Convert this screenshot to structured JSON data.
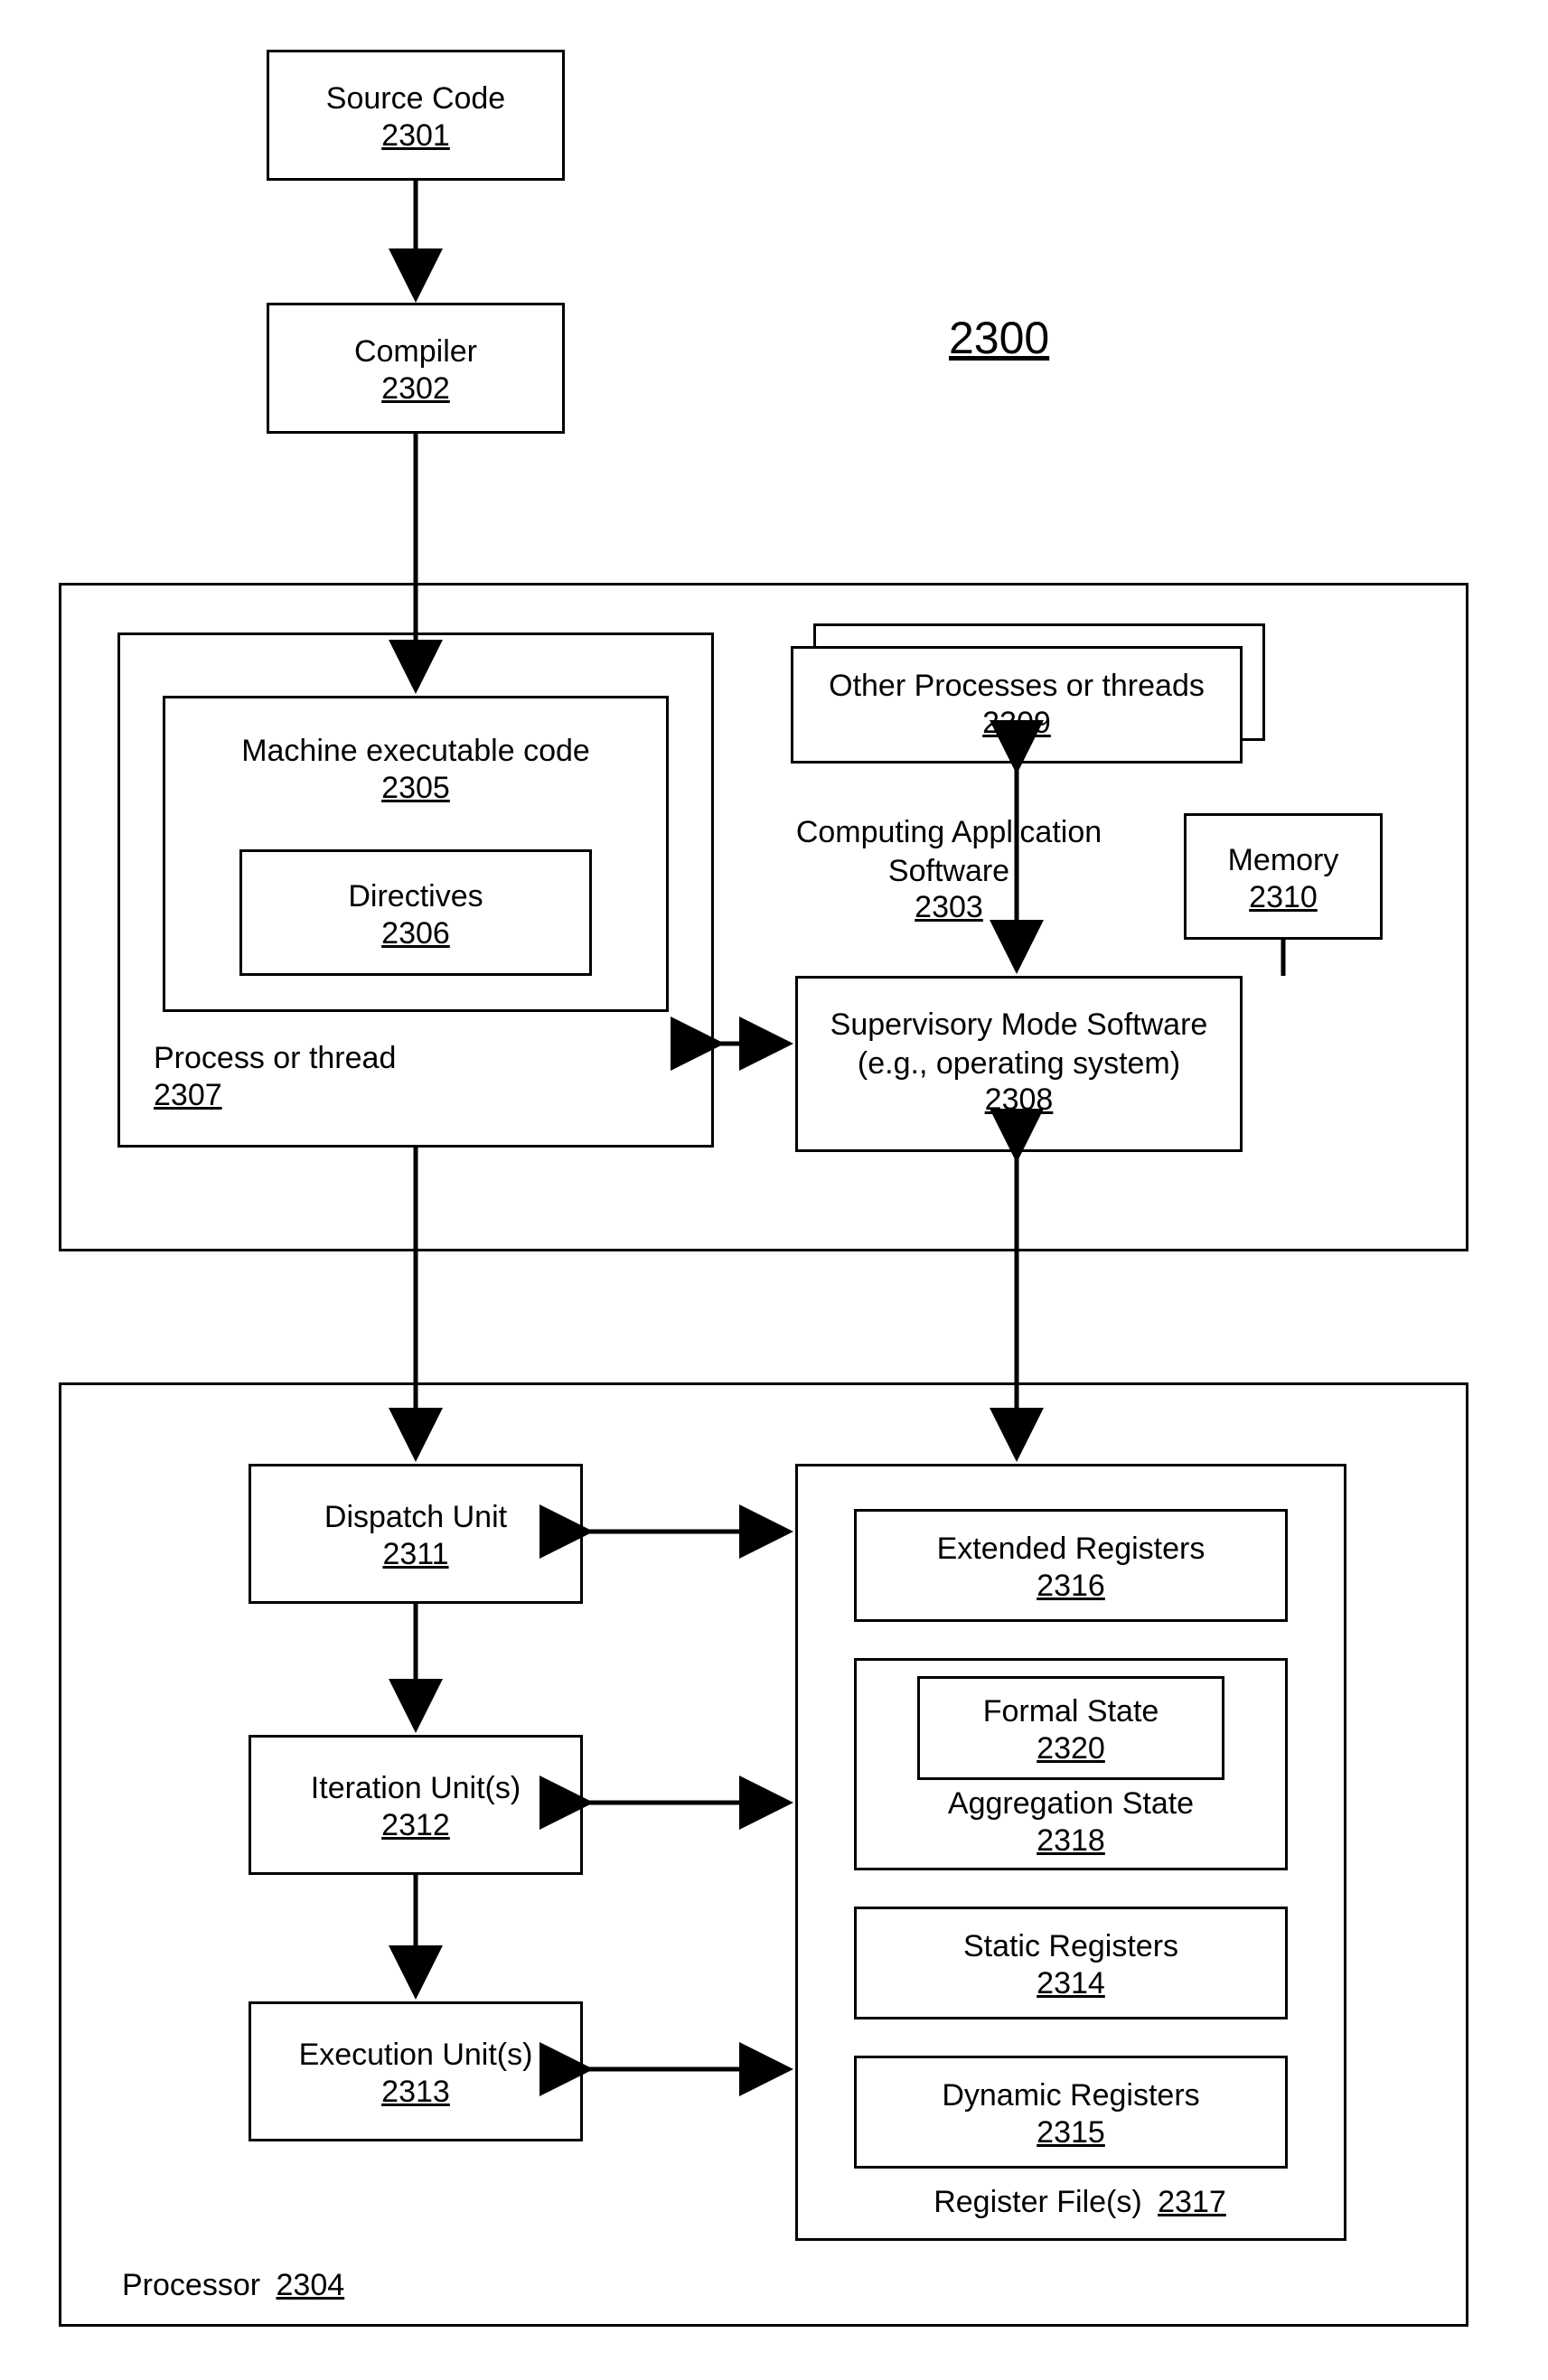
{
  "figure_number": "2300",
  "nodes": {
    "source_code": {
      "label": "Source Code",
      "num": "2301"
    },
    "compiler": {
      "label": "Compiler",
      "num": "2302"
    },
    "cas": {
      "label": "Computing Application\nSoftware",
      "num": "2303"
    },
    "process": {
      "label": "Process or thread",
      "num": "2307"
    },
    "mexec": {
      "label": "Machine executable code",
      "num": "2305"
    },
    "directives": {
      "label": "Directives",
      "num": "2306"
    },
    "other": {
      "label": "Other Processes or threads",
      "num": "2309"
    },
    "supervisory": {
      "label": "Supervisory Mode Software\n(e.g., operating system)",
      "num": "2308"
    },
    "memory": {
      "label": "Memory",
      "num": "2310"
    },
    "processor": {
      "label": "Processor",
      "num": "2304"
    },
    "dispatch": {
      "label": "Dispatch Unit",
      "num": "2311"
    },
    "iteration": {
      "label": "Iteration Unit(s)",
      "num": "2312"
    },
    "execution": {
      "label": "Execution Unit(s)",
      "num": "2313"
    },
    "regfile": {
      "label": "Register File(s)",
      "num": "2317"
    },
    "extended": {
      "label": "Extended Registers",
      "num": "2316"
    },
    "aggstate": {
      "label": "Aggregation State",
      "num": "2318"
    },
    "formal": {
      "label": "Formal State",
      "num": "2320"
    },
    "static": {
      "label": "Static Registers",
      "num": "2314"
    },
    "dynamic": {
      "label": "Dynamic Registers",
      "num": "2315"
    }
  }
}
